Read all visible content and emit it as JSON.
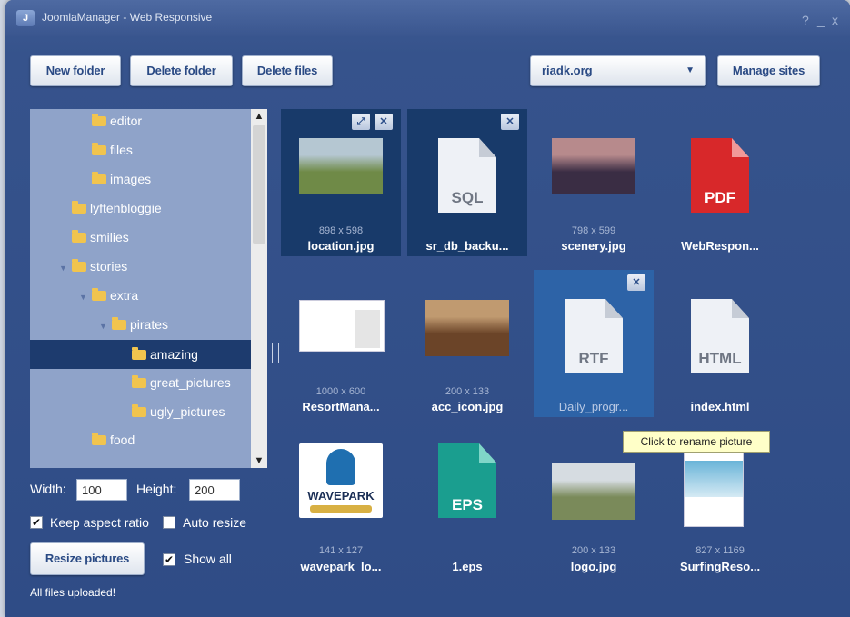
{
  "window": {
    "title": "JoomlaManager - Web Responsive",
    "icon_letter": "J",
    "controls": [
      "?",
      "_",
      "x"
    ]
  },
  "toolbar": {
    "new_folder": "New folder",
    "delete_folder": "Delete folder",
    "delete_files": "Delete files",
    "site": "riadk.org",
    "manage_sites": "Manage sites"
  },
  "tree": {
    "items": [
      {
        "label": "editor"
      },
      {
        "label": "files"
      },
      {
        "label": "images"
      },
      {
        "label": "lyftenbloggie"
      },
      {
        "label": "smilies"
      },
      {
        "label": "stories"
      },
      {
        "label": "extra"
      },
      {
        "label": "pirates"
      },
      {
        "label": "amazing"
      },
      {
        "label": "great_pictures"
      },
      {
        "label": "ugly_pictures"
      },
      {
        "label": "food"
      }
    ],
    "selected": "amazing"
  },
  "options": {
    "width_label": "Width:",
    "width_value": "100",
    "height_label": "Height:",
    "height_value": "200",
    "keep_aspect_label": "Keep aspect ratio",
    "keep_aspect_checked": true,
    "auto_resize_label": "Auto resize",
    "auto_resize_checked": false,
    "resize_button": "Resize pictures",
    "show_all_label": "Show all",
    "show_all_checked": true
  },
  "status": "All files uploaded!",
  "files": [
    {
      "name": "location.jpg",
      "dims": "898 x 598",
      "kind": "image",
      "colors": [
        "#6f8a47",
        "#b5c7d2"
      ],
      "state": "selected"
    },
    {
      "name": "sr_db_backu...",
      "dims": "",
      "kind": "doc",
      "ext": "SQL",
      "state": "selected"
    },
    {
      "name": "scenery.jpg",
      "dims": "798 x 599",
      "kind": "image",
      "colors": [
        "#3a2d44",
        "#b78a8c"
      ]
    },
    {
      "name": "WebRespon...",
      "dims": "",
      "kind": "pdf",
      "ext": "PDF"
    },
    {
      "name": "ResortMana...",
      "dims": "1000 x 600",
      "kind": "screenshot"
    },
    {
      "name": "acc_icon.jpg",
      "dims": "200 x 133",
      "kind": "image",
      "colors": [
        "#6b4428",
        "#c09a70"
      ]
    },
    {
      "name": "Daily_progr...",
      "dims": "",
      "kind": "doc",
      "ext": "RTF",
      "state": "hover"
    },
    {
      "name": "index.html",
      "dims": "",
      "kind": "doc",
      "ext": "HTML"
    },
    {
      "name": "wavepark_lo...",
      "dims": "141 x 127",
      "kind": "logo",
      "logo_text": "WAVEPARK"
    },
    {
      "name": "1.eps",
      "dims": "",
      "kind": "eps",
      "ext": "EPS"
    },
    {
      "name": "logo.jpg",
      "dims": "200 x 133",
      "kind": "image",
      "colors": [
        "#7a8a5a",
        "#d6dce1"
      ]
    },
    {
      "name": "SurfingReso...",
      "dims": "827 x 1169",
      "kind": "brochure"
    }
  ],
  "tooltip": "Click to rename picture",
  "icons": {
    "fullscreen": "expand-icon",
    "close": "close-icon"
  }
}
